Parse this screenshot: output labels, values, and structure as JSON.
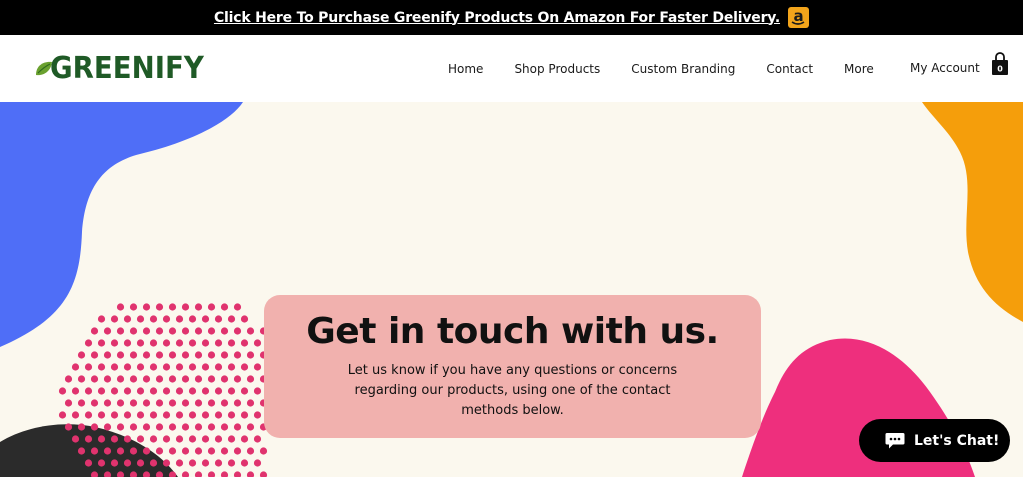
{
  "promo": {
    "link_text": "Click Here To Purchase Greenify Products On Amazon For Faster Delivery.",
    "icon": "amazon-icon"
  },
  "header": {
    "logo_text": "GREENIFY",
    "nav": [
      "Home",
      "Shop Products",
      "Custom Branding",
      "Contact",
      "More"
    ],
    "account_label": "My Account",
    "cart_count": "0"
  },
  "hero": {
    "title": "Get in touch with us.",
    "description": "Let us know if you have any questions or concerns regarding our products, using one of the contact methods below."
  },
  "chat": {
    "label": "Let's Chat!",
    "icon": "chat-bubble-icon"
  },
  "colors": {
    "background": "#fbf8ee",
    "blue_blob": "#4f6ef7",
    "orange_blob": "#f59e0b",
    "pink_blob": "#ee2f7d",
    "dots": "#e0336e",
    "card": "#f1b1ae",
    "logo_green": "#1f5a26"
  }
}
